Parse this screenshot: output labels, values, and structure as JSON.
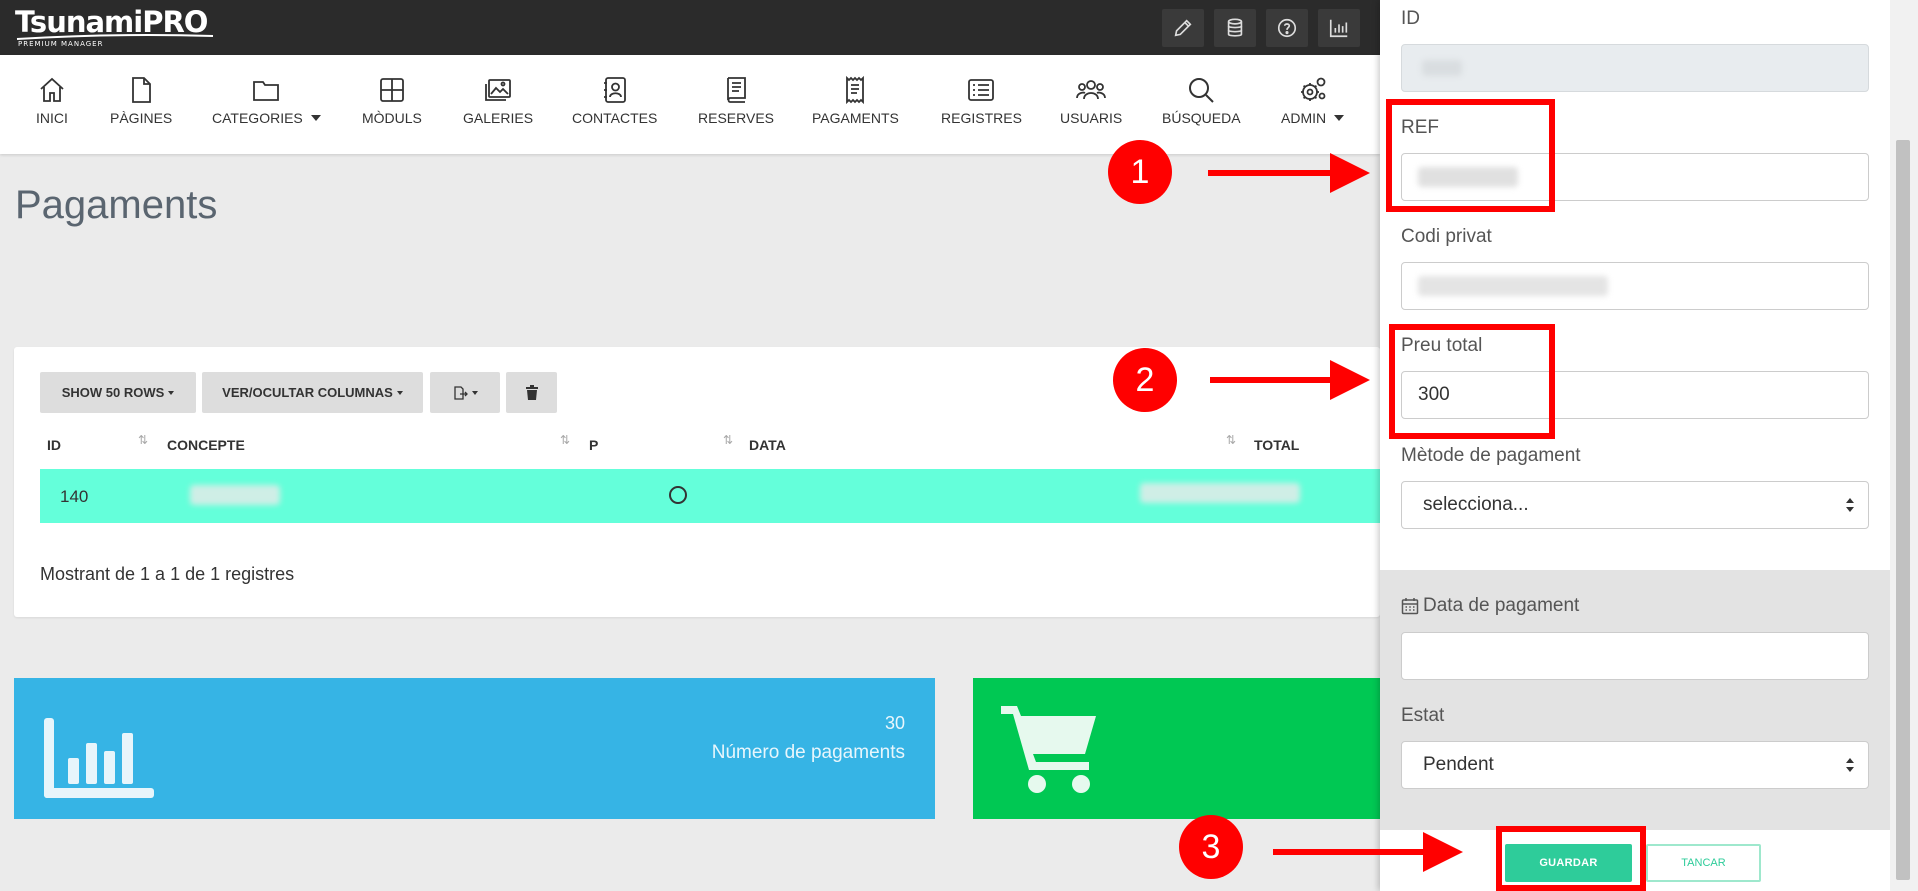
{
  "app": {
    "logo_main": "TsunamiPRO",
    "logo_sub": "PREMIUM MANAGER"
  },
  "toolbar_icons": [
    "pencil-icon",
    "database-icon",
    "help-icon",
    "chart-icon"
  ],
  "nav": [
    {
      "label": "INICI",
      "icon": "home-icon"
    },
    {
      "label": "PÀGINES",
      "icon": "page-icon"
    },
    {
      "label": "CATEGORIES",
      "icon": "folder-icon",
      "dropdown": true
    },
    {
      "label": "MÒDULS",
      "icon": "grid-icon"
    },
    {
      "label": "GALERIES",
      "icon": "gallery-icon"
    },
    {
      "label": "CONTACTES",
      "icon": "contact-icon"
    },
    {
      "label": "RESERVES",
      "icon": "book-icon"
    },
    {
      "label": "PAGAMENTS",
      "icon": "receipt-icon"
    },
    {
      "label": "REGISTRES",
      "icon": "list-icon"
    },
    {
      "label": "USUARIS",
      "icon": "users-icon"
    },
    {
      "label": "BÚSQUEDA",
      "icon": "search-icon"
    },
    {
      "label": "ADMIN",
      "icon": "gears-icon",
      "dropdown": true
    }
  ],
  "page": {
    "title": "Pagaments"
  },
  "table": {
    "show_rows_label": "SHOW 50 ROWS",
    "toggle_columns_label": "VER/OCULTAR COLUMNAS",
    "columns": [
      "ID",
      "CONCEPTE",
      "P",
      "DATA",
      "TOTAL"
    ],
    "rows": [
      {
        "id": "140"
      }
    ],
    "footer": "Mostrant de 1 a 1 de 1 registres"
  },
  "stats": {
    "count": "30",
    "count_label": "Número de pagaments"
  },
  "form": {
    "id_label": "ID",
    "ref_label": "REF",
    "private_code_label": "Codi privat",
    "total_price_label": "Preu total",
    "total_price_value": "300",
    "payment_method_label": "Mètode de pagament",
    "payment_method_value": "selecciona...",
    "payment_date_label": "Data de pagament",
    "status_label": "Estat",
    "status_value": "Pendent",
    "save_label": "GUARDAR",
    "close_label": "TANCAR"
  },
  "annotations": {
    "step1": "1",
    "step2": "2",
    "step3": "3",
    "color": "#ff0000"
  },
  "colors": {
    "row_highlight": "#64ffda",
    "stat_blue": "#36b4e5",
    "stat_green": "#00c853",
    "save_button": "#2ecc9a",
    "topbar": "#2b2b2b"
  }
}
